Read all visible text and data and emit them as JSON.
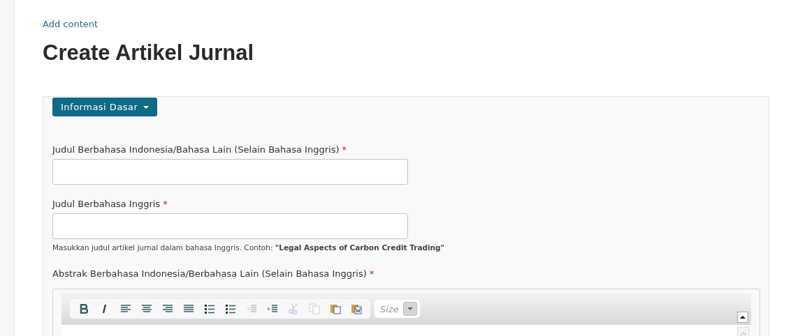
{
  "breadcrumb": "Add content",
  "title": "Create Artikel Jurnal",
  "section_button": {
    "label": "Informasi Dasar"
  },
  "fields": [
    {
      "kind": "input",
      "label": "Judul Berbahasa Indonesia/Bahasa Lain (Selain Bahasa Inggris)",
      "required_mark": "*"
    },
    {
      "kind": "input",
      "label": "Judul Berbahasa Inggris",
      "required_mark": "*",
      "description": "Masukkan judul artikel jurnal dalam bahasa Inggris. Contoh: **\"Legal Aspects of Carbon Credit Trading\"**"
    },
    {
      "kind": "editor",
      "label": "Abstrak Berbahasa Indonesia/Berbahasa Lain (Selain Bahasa Inggris)",
      "required_mark": "*",
      "toolbar": [
        {
          "kind": "bold",
          "disabled": false
        },
        {
          "kind": "italic",
          "disabled": false
        },
        {
          "kind": "align-left",
          "disabled": false
        },
        {
          "kind": "align-center",
          "disabled": false
        },
        {
          "kind": "align-right",
          "disabled": false
        },
        {
          "kind": "justify",
          "disabled": false
        },
        {
          "kind": "bullets",
          "disabled": false
        },
        {
          "kind": "numbers",
          "disabled": false
        },
        {
          "kind": "outdent",
          "disabled": true
        },
        {
          "kind": "indent",
          "disabled": false
        },
        {
          "kind": "cut",
          "disabled": true
        },
        {
          "kind": "copy",
          "disabled": true
        },
        {
          "kind": "paste",
          "disabled": false
        },
        {
          "kind": "paste-word",
          "disabled": false
        }
      ],
      "size_placeholder": "Size"
    }
  ]
}
